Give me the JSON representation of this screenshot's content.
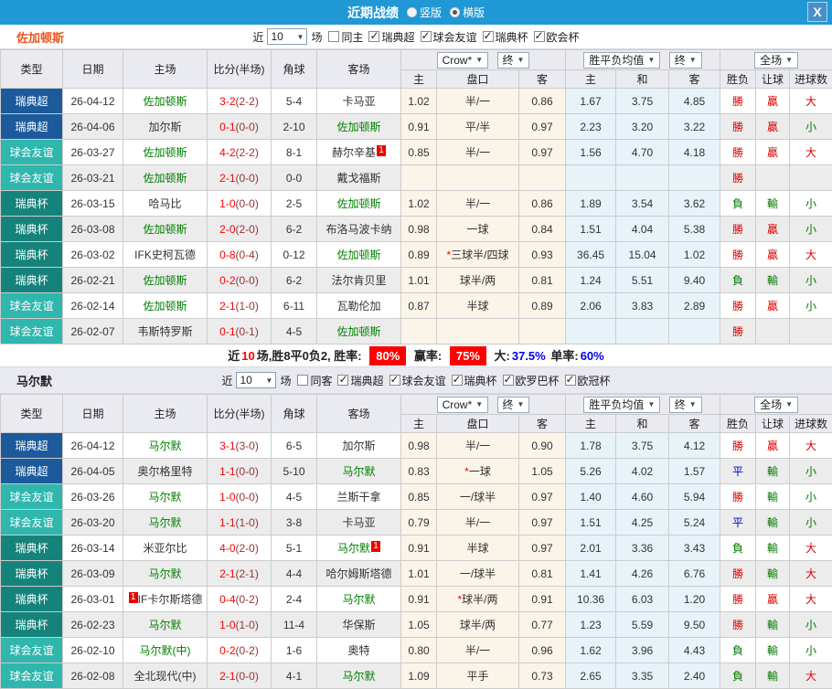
{
  "titlebar": {
    "title": "近期战绩",
    "radio_options": [
      {
        "label": "竖版",
        "selected": false
      },
      {
        "label": "横版",
        "selected": true
      }
    ],
    "close_label": "X"
  },
  "header": {
    "cols": [
      "类型",
      "日期",
      "主场",
      "比分(半场)",
      "角球",
      "客场"
    ],
    "group1_dropdown": "Crow*",
    "group1_final": "终",
    "group1_cols": [
      "主",
      "盘口",
      "客"
    ],
    "group2_dropdown": "胜平负均值",
    "group2_final": "终",
    "group2_cols": [
      "主",
      "和",
      "客"
    ],
    "group3_dropdown": "全场",
    "group3_cols": [
      "胜负",
      "让球",
      "进球数"
    ]
  },
  "colors": {
    "titlebar_blue": "#2098d5",
    "league_super_blue": "#1d5a9b",
    "league_friendly_teal": "#2fb6ad",
    "league_cup_teal": "#15837b",
    "win_red": "#dd0000",
    "draw_blue": "#0000cc",
    "lose_green": "#007a00",
    "team_green": "#008000"
  },
  "sections": [
    {
      "team": "佐加顿斯",
      "team_color": "#f0551e",
      "filter": {
        "near": "近",
        "count": "10",
        "games": "场",
        "same": {
          "label": "同主",
          "checked": false
        },
        "leagues": [
          {
            "label": "瑞典超",
            "checked": true
          },
          {
            "label": "球会友谊",
            "checked": true
          },
          {
            "label": "瑞典杯",
            "checked": true
          },
          {
            "label": "欧会杯",
            "checked": true
          }
        ]
      },
      "rows": [
        {
          "league": "瑞典超",
          "date": "26-04-12",
          "home": "佐加顿斯",
          "home_green": true,
          "home_badge": "",
          "home_badge_pos": "",
          "score": "3-2",
          "half": "(2-2)",
          "corner": "5-4",
          "away": "卡马亚",
          "away_green": false,
          "away_badge": "",
          "away_badge_pos": "",
          "o1": "1.02",
          "hcap": "半/一",
          "o2": "0.86",
          "a1": "1.67",
          "a2": "3.75",
          "a3": "4.85",
          "r1": "勝",
          "r2": "贏",
          "r3": "大"
        },
        {
          "league": "瑞典超",
          "date": "26-04-06",
          "home": "加尔斯",
          "home_green": false,
          "home_badge": "",
          "home_badge_pos": "",
          "score": "0-1",
          "half": "(0-0)",
          "corner": "2-10",
          "away": "佐加顿斯",
          "away_green": true,
          "away_badge": "",
          "away_badge_pos": "",
          "o1": "0.91",
          "hcap": "平/半",
          "o2": "0.97",
          "a1": "2.23",
          "a2": "3.20",
          "a3": "3.22",
          "r1": "勝",
          "r2": "贏",
          "r3": "小"
        },
        {
          "league": "球会友谊",
          "date": "26-03-27",
          "home": "佐加顿斯",
          "home_green": true,
          "home_badge": "",
          "home_badge_pos": "",
          "score": "4-2",
          "half": "(2-2)",
          "corner": "8-1",
          "away": "赫尔辛基",
          "away_green": false,
          "away_badge": "1",
          "away_badge_pos": "after",
          "o1": "0.85",
          "hcap": "半/一",
          "o2": "0.97",
          "a1": "1.56",
          "a2": "4.70",
          "a3": "4.18",
          "r1": "勝",
          "r2": "贏",
          "r3": "大"
        },
        {
          "league": "球会友谊",
          "date": "26-03-21",
          "home": "佐加顿斯",
          "home_green": true,
          "home_badge": "",
          "home_badge_pos": "",
          "score": "2-1",
          "half": "(0-0)",
          "corner": "0-0",
          "away": "戴戈福斯",
          "away_green": false,
          "away_badge": "",
          "away_badge_pos": "",
          "o1": "",
          "hcap": "",
          "o2": "",
          "a1": "",
          "a2": "",
          "a3": "",
          "r1": "勝",
          "r2": "",
          "r3": ""
        },
        {
          "league": "瑞典杯",
          "date": "26-03-15",
          "home": "哈马比",
          "home_green": false,
          "home_badge": "",
          "home_badge_pos": "",
          "score": "1-0",
          "half": "(0-0)",
          "corner": "2-5",
          "away": "佐加顿斯",
          "away_green": true,
          "away_badge": "",
          "away_badge_pos": "",
          "o1": "1.02",
          "hcap": "半/一",
          "o2": "0.86",
          "a1": "1.89",
          "a2": "3.54",
          "a3": "3.62",
          "r1": "負",
          "r2": "輸",
          "r3": "小"
        },
        {
          "league": "瑞典杯",
          "date": "26-03-08",
          "home": "佐加顿斯",
          "home_green": true,
          "home_badge": "",
          "home_badge_pos": "",
          "score": "2-0",
          "half": "(2-0)",
          "corner": "6-2",
          "away": "布洛马波卡纳",
          "away_green": false,
          "away_badge": "",
          "away_badge_pos": "",
          "o1": "0.98",
          "hcap": "一球",
          "o2": "0.84",
          "a1": "1.51",
          "a2": "4.04",
          "a3": "5.38",
          "r1": "勝",
          "r2": "贏",
          "r3": "小"
        },
        {
          "league": "瑞典杯",
          "date": "26-03-02",
          "home": "IFK史柯瓦德",
          "home_green": false,
          "home_badge": "",
          "home_badge_pos": "",
          "score": "0-8",
          "half": "(0-4)",
          "corner": "0-12",
          "away": "佐加顿斯",
          "away_green": true,
          "away_badge": "",
          "away_badge_pos": "",
          "o1": "0.89",
          "hcap": "*三球半/四球",
          "o2": "0.93",
          "a1": "36.45",
          "a2": "15.04",
          "a3": "1.02",
          "r1": "勝",
          "r2": "贏",
          "r3": "大"
        },
        {
          "league": "瑞典杯",
          "date": "26-02-21",
          "home": "佐加顿斯",
          "home_green": true,
          "home_badge": "",
          "home_badge_pos": "",
          "score": "0-2",
          "half": "(0-0)",
          "corner": "6-2",
          "away": "法尔肯贝里",
          "away_green": false,
          "away_badge": "",
          "away_badge_pos": "",
          "o1": "1.01",
          "hcap": "球半/两",
          "o2": "0.81",
          "a1": "1.24",
          "a2": "5.51",
          "a3": "9.40",
          "r1": "負",
          "r2": "輸",
          "r3": "小"
        },
        {
          "league": "球会友谊",
          "date": "26-02-14",
          "home": "佐加顿斯",
          "home_green": true,
          "home_badge": "",
          "home_badge_pos": "",
          "score": "2-1",
          "half": "(1-0)",
          "corner": "6-11",
          "away": "瓦勒伦加",
          "away_green": false,
          "away_badge": "",
          "away_badge_pos": "",
          "o1": "0.87",
          "hcap": "半球",
          "o2": "0.89",
          "a1": "2.06",
          "a2": "3.83",
          "a3": "2.89",
          "r1": "勝",
          "r2": "贏",
          "r3": "小"
        },
        {
          "league": "球会友谊",
          "date": "26-02-07",
          "home": "韦斯特罗斯",
          "home_green": false,
          "home_badge": "",
          "home_badge_pos": "",
          "score": "0-1",
          "half": "(0-1)",
          "corner": "4-5",
          "away": "佐加顿斯",
          "away_green": true,
          "away_badge": "",
          "away_badge_pos": "",
          "o1": "",
          "hcap": "",
          "o2": "",
          "a1": "",
          "a2": "",
          "a3": "",
          "r1": "勝",
          "r2": "",
          "r3": ""
        }
      ],
      "summary": {
        "prefix": "近",
        "count": "10",
        "record": "场,胜8平0负2, 胜率:",
        "win_rate": "80%",
        "handicap_label": "赢率:",
        "handicap_rate": "75%",
        "big_label": "大:",
        "big_rate": "37.5%",
        "single_label": "单率:",
        "single_rate": "60%"
      }
    },
    {
      "team": "马尔默",
      "team_color": "#222222",
      "filter": {
        "near": "近",
        "count": "10",
        "games": "场",
        "same": {
          "label": "同客",
          "checked": false
        },
        "leagues": [
          {
            "label": "瑞典超",
            "checked": true
          },
          {
            "label": "球会友谊",
            "checked": true
          },
          {
            "label": "瑞典杯",
            "checked": true
          },
          {
            "label": "欧罗巴杯",
            "checked": true
          },
          {
            "label": "欧冠杯",
            "checked": true
          }
        ]
      },
      "rows": [
        {
          "league": "瑞典超",
          "date": "26-04-12",
          "home": "马尔默",
          "home_green": true,
          "home_badge": "",
          "home_badge_pos": "",
          "score": "3-1",
          "half": "(3-0)",
          "corner": "6-5",
          "away": "加尔斯",
          "away_green": false,
          "away_badge": "",
          "away_badge_pos": "",
          "o1": "0.98",
          "hcap": "半/一",
          "o2": "0.90",
          "a1": "1.78",
          "a2": "3.75",
          "a3": "4.12",
          "r1": "勝",
          "r2": "贏",
          "r3": "大"
        },
        {
          "league": "瑞典超",
          "date": "26-04-05",
          "home": "奥尔格里特",
          "home_green": false,
          "home_badge": "",
          "home_badge_pos": "",
          "score": "1-1",
          "half": "(0-0)",
          "corner": "5-10",
          "away": "马尔默",
          "away_green": true,
          "away_badge": "",
          "away_badge_pos": "",
          "o1": "0.83",
          "hcap": "*一球",
          "o2": "1.05",
          "a1": "5.26",
          "a2": "4.02",
          "a3": "1.57",
          "r1": "平",
          "r2": "輸",
          "r3": "小"
        },
        {
          "league": "球会友谊",
          "date": "26-03-26",
          "home": "马尔默",
          "home_green": true,
          "home_badge": "",
          "home_badge_pos": "",
          "score": "1-0",
          "half": "(0-0)",
          "corner": "4-5",
          "away": "兰斯干拿",
          "away_green": false,
          "away_badge": "",
          "away_badge_pos": "",
          "o1": "0.85",
          "hcap": "一/球半",
          "o2": "0.97",
          "a1": "1.40",
          "a2": "4.60",
          "a3": "5.94",
          "r1": "勝",
          "r2": "輸",
          "r3": "小"
        },
        {
          "league": "球会友谊",
          "date": "26-03-20",
          "home": "马尔默",
          "home_green": true,
          "home_badge": "",
          "home_badge_pos": "",
          "score": "1-1",
          "half": "(1-0)",
          "corner": "3-8",
          "away": "卡马亚",
          "away_green": false,
          "away_badge": "",
          "away_badge_pos": "",
          "o1": "0.79",
          "hcap": "半/一",
          "o2": "0.97",
          "a1": "1.51",
          "a2": "4.25",
          "a3": "5.24",
          "r1": "平",
          "r2": "輸",
          "r3": "小"
        },
        {
          "league": "瑞典杯",
          "date": "26-03-14",
          "home": "米亚尔比",
          "home_green": false,
          "home_badge": "",
          "home_badge_pos": "",
          "score": "4-0",
          "half": "(2-0)",
          "corner": "5-1",
          "away": "马尔默",
          "away_green": true,
          "away_badge": "1",
          "away_badge_pos": "after",
          "o1": "0.91",
          "hcap": "半球",
          "o2": "0.97",
          "a1": "2.01",
          "a2": "3.36",
          "a3": "3.43",
          "r1": "負",
          "r2": "輸",
          "r3": "大"
        },
        {
          "league": "瑞典杯",
          "date": "26-03-09",
          "home": "马尔默",
          "home_green": true,
          "home_badge": "",
          "home_badge_pos": "",
          "score": "2-1",
          "half": "(2-1)",
          "corner": "4-4",
          "away": "哈尔姆斯塔德",
          "away_green": false,
          "away_badge": "",
          "away_badge_pos": "",
          "o1": "1.01",
          "hcap": "一/球半",
          "o2": "0.81",
          "a1": "1.41",
          "a2": "4.26",
          "a3": "6.76",
          "r1": "勝",
          "r2": "輸",
          "r3": "大"
        },
        {
          "league": "瑞典杯",
          "date": "26-03-01",
          "home": "IF卡尔斯塔德",
          "home_green": false,
          "home_badge": "1",
          "home_badge_pos": "before",
          "score": "0-4",
          "half": "(0-2)",
          "corner": "2-4",
          "away": "马尔默",
          "away_green": true,
          "away_badge": "",
          "away_badge_pos": "",
          "o1": "0.91",
          "hcap": "*球半/两",
          "o2": "0.91",
          "a1": "10.36",
          "a2": "6.03",
          "a3": "1.20",
          "r1": "勝",
          "r2": "贏",
          "r3": "大"
        },
        {
          "league": "瑞典杯",
          "date": "26-02-23",
          "home": "马尔默",
          "home_green": true,
          "home_badge": "",
          "home_badge_pos": "",
          "score": "1-0",
          "half": "(1-0)",
          "corner": "11-4",
          "away": "华保斯",
          "away_green": false,
          "away_badge": "",
          "away_badge_pos": "",
          "o1": "1.05",
          "hcap": "球半/两",
          "o2": "0.77",
          "a1": "1.23",
          "a2": "5.59",
          "a3": "9.50",
          "r1": "勝",
          "r2": "輸",
          "r3": "小"
        },
        {
          "league": "球会友谊",
          "date": "26-02-10",
          "home": "马尔默(中)",
          "home_green": true,
          "home_badge": "",
          "home_badge_pos": "",
          "score": "0-2",
          "half": "(0-2)",
          "corner": "1-6",
          "away": "奥特",
          "away_green": false,
          "away_badge": "",
          "away_badge_pos": "",
          "o1": "0.80",
          "hcap": "半/一",
          "o2": "0.96",
          "a1": "1.62",
          "a2": "3.96",
          "a3": "4.43",
          "r1": "負",
          "r2": "輸",
          "r3": "小"
        },
        {
          "league": "球会友谊",
          "date": "26-02-08",
          "home": "全北现代(中)",
          "home_green": false,
          "home_badge": "",
          "home_badge_pos": "",
          "score": "2-1",
          "half": "(0-0)",
          "corner": "4-1",
          "away": "马尔默",
          "away_green": true,
          "away_badge": "",
          "away_badge_pos": "",
          "o1": "1.09",
          "hcap": "平手",
          "o2": "0.73",
          "a1": "2.65",
          "a2": "3.35",
          "a3": "2.40",
          "r1": "負",
          "r2": "輸",
          "r3": "大"
        }
      ],
      "summary": null
    }
  ]
}
